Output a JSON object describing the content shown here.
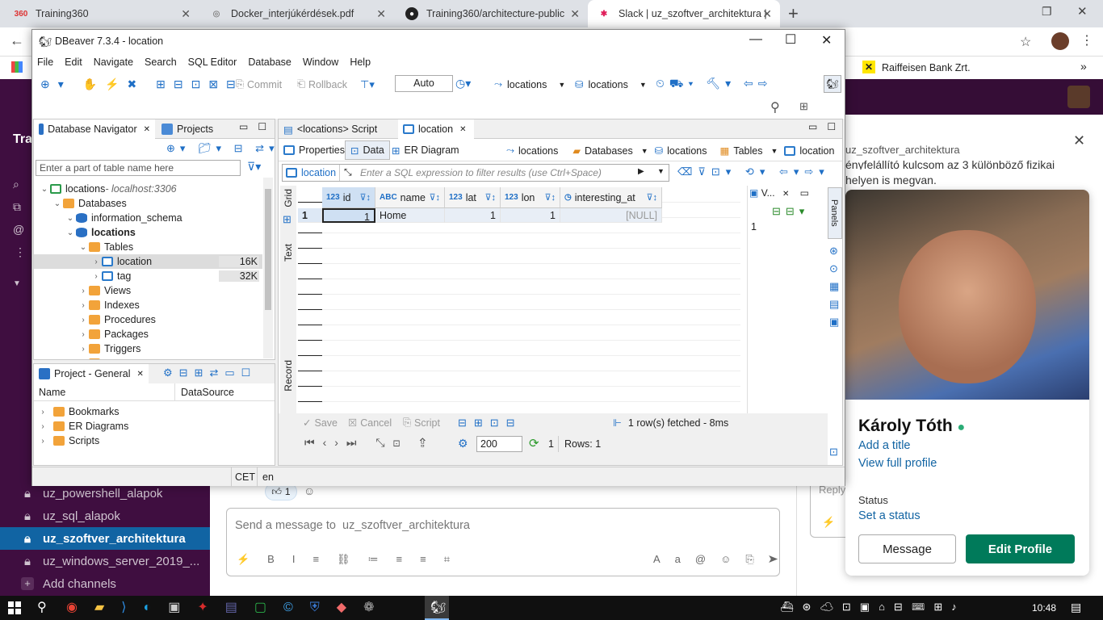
{
  "browser": {
    "tabs": [
      {
        "label": "Training360",
        "fav": "360"
      },
      {
        "label": "Docker_interjúkérdések.pdf",
        "fav": "pdf"
      },
      {
        "label": "Training360/architecture-public",
        "fav": "gh"
      },
      {
        "label": "Slack | uz_szoftver_architektura |",
        "fav": "sl"
      }
    ],
    "new_tab": "+",
    "bookmark": "Raiffeisen Bank Zrt.",
    "more": "»"
  },
  "slack": {
    "channels": [
      "uz_powershell_alapok",
      "uz_sql_alapok",
      "uz_szoftver_architektura",
      "uz_windows_server_2019_..."
    ],
    "add_channels": "Add channels",
    "team_initial": "Tra",
    "reaction_count": "1",
    "message_placeholder": "Send a message to  uz_szoftver_architektura",
    "snippet_line1": "ényfelállító kulcsom az 3 különböző fizikai",
    "snippet_line2": "helyen is megvan.",
    "reply_placeholder": "Reply…",
    "channel_header": "uz_szoftver_architektura",
    "close": "✕",
    "profile": {
      "name": "Károly Tóth",
      "add_title": "Add a title",
      "view_full": "View full profile",
      "status_label": "Status",
      "set_status": "Set a status",
      "message_btn": "Message",
      "edit_btn": "Edit Profile"
    }
  },
  "dbeaver": {
    "title": "DBeaver 7.3.4 - location",
    "menu": [
      "File",
      "Edit",
      "Navigate",
      "Search",
      "SQL Editor",
      "Database",
      "Window",
      "Help"
    ],
    "toolbar": {
      "commit": "Commit",
      "rollback": "Rollback",
      "mode": "Auto",
      "ds1": "locations",
      "ds2": "locations"
    },
    "navigator": {
      "tab1": "Database Navigator",
      "tab2": "Projects",
      "filter_placeholder": "Enter a part of table name here",
      "tree": [
        {
          "label": "locations",
          "extra": " - localhost:3306",
          "indent": 0
        },
        {
          "label": "Databases",
          "indent": 1
        },
        {
          "label": "information_schema",
          "indent": 2
        },
        {
          "label": "locations",
          "indent": 2
        },
        {
          "label": "Tables",
          "indent": 3
        },
        {
          "label": "location",
          "indent": 4,
          "size": "16K"
        },
        {
          "label": "tag",
          "indent": 4,
          "size": "32K"
        },
        {
          "label": "Views",
          "indent": 3
        },
        {
          "label": "Indexes",
          "indent": 3
        },
        {
          "label": "Procedures",
          "indent": 3
        },
        {
          "label": "Packages",
          "indent": 3
        },
        {
          "label": "Triggers",
          "indent": 3
        },
        {
          "label": "Events",
          "indent": 3
        }
      ]
    },
    "project": {
      "tab": "Project - General",
      "col_name": "Name",
      "col_ds": "DataSource",
      "items": [
        "Bookmarks",
        "ER Diagrams",
        "Scripts"
      ]
    },
    "status_bar": {
      "tz": "CET",
      "lang": "en"
    },
    "editor": {
      "tab1": "<locations> Script",
      "tab2": "location",
      "subtabs": [
        "Properties",
        "Data",
        "ER Diagram"
      ],
      "crumbs": [
        "locations",
        "Databases",
        "locations",
        "Tables",
        "location"
      ],
      "filter_label": "location",
      "filter_placeholder": "Enter a SQL expression to filter results (use Ctrl+Space)",
      "side_labels": [
        "Grid",
        "Text",
        "Record"
      ],
      "columns": [
        {
          "name": "id",
          "type": "123"
        },
        {
          "name": "name",
          "type": "ABC"
        },
        {
          "name": "lat",
          "type": "123"
        },
        {
          "name": "lon",
          "type": "123"
        },
        {
          "name": "interesting_at",
          "type": "◷"
        }
      ],
      "rows": [
        {
          "num": "1",
          "id": "1",
          "name": "Home",
          "lat": "1",
          "lon": "1",
          "interesting_at": "[NULL]"
        }
      ],
      "value_panel": {
        "title": "V...",
        "value": "1"
      },
      "panels_label": "Panels",
      "bottom": {
        "save": "Save",
        "cancel": "Cancel",
        "script": "Script",
        "fetched": "1 row(s) fetched - 8ms",
        "fetch_size": "200",
        "refresh_count": "1",
        "rows": "Rows: 1"
      }
    }
  },
  "taskbar": {
    "time": "10:48"
  }
}
